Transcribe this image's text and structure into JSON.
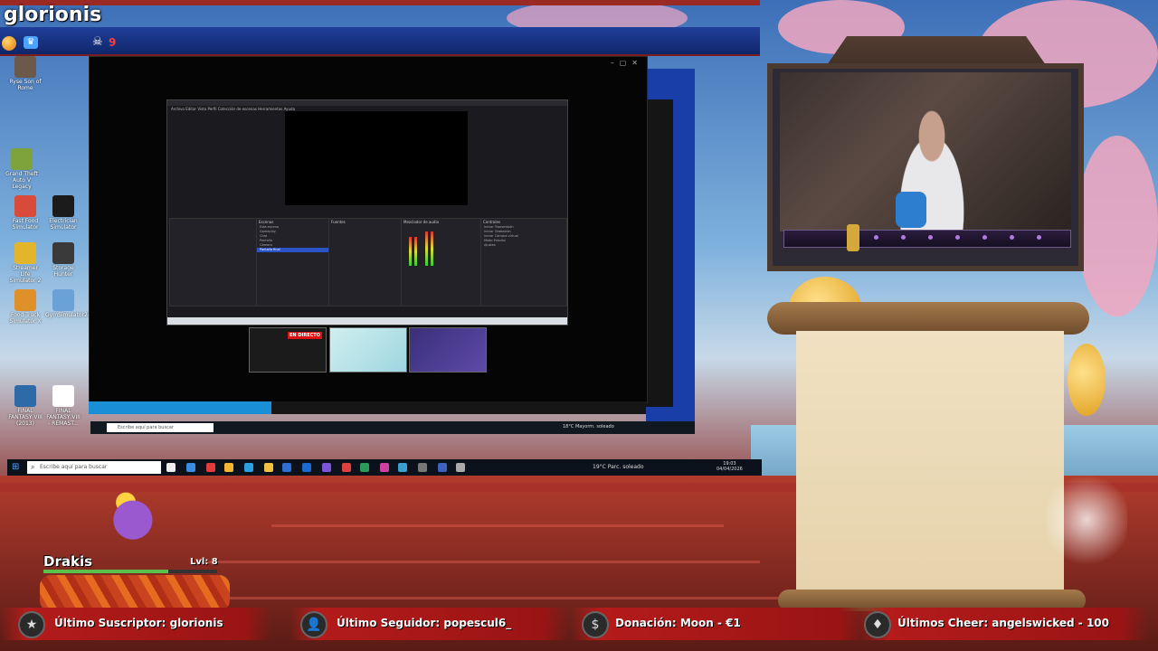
{
  "overlay": {
    "channel_name": "glorionis",
    "death_count": "9"
  },
  "desktop_icons": [
    {
      "label": "Ryse Son of Rome",
      "color": "#6b5a4a"
    },
    {
      "label": "Grand Theft Auto V Legacy",
      "color": "#7ea33c"
    },
    {
      "label": "Fast Food Simulator",
      "color": "#d84a3a"
    },
    {
      "label": "Electrician Simulator",
      "color": "#1b1b1b"
    },
    {
      "label": "Streamer Life Simulator 2",
      "color": "#e2b52b"
    },
    {
      "label": "Storage Hunter",
      "color": "#3a3a3a"
    },
    {
      "label": "Food Truck Simulator X",
      "color": "#e0902a"
    },
    {
      "label": "GymSimulator24",
      "color": "#6aa2d8"
    },
    {
      "label": "FINAL FANTASY VIII (2013)",
      "color": "#2e6aa8"
    },
    {
      "label": "FINAL FANTASY VIII - REMAST...",
      "color": "#ffffff"
    }
  ],
  "obs": {
    "live_badge": "EN DIRECTO",
    "mini_search_placeholder": "Escribe aquí para buscar",
    "mini_weather": "18°C Mayorm. soleado",
    "inner_menu": "Archivo  Editar  Vista  Perfil  Colección de escenas  Herramientas  Ayuda",
    "scenes_header": "Escenas",
    "scenes": [
      "Esta escena",
      "Gameplay",
      "Chat",
      "Pantalla",
      "Cámara",
      "Pantalla final"
    ],
    "selected_scene_index": 5,
    "sources_header": "Fuentes",
    "mixer_header": "Mezclador de audio",
    "controls_header": "Controles",
    "controls": [
      "Iniciar Transmisión",
      "Iniciar Grabación",
      "Iniciar Cámara virtual",
      "Modo Estudio",
      "Ajustes"
    ]
  },
  "taskbar": {
    "search_placeholder": "Escribe aquí para buscar",
    "weather": "19°C Parc. soleado",
    "time": "19:03",
    "date": "04/04/2026"
  },
  "character": {
    "name": "Drakis",
    "level": "Lvl: 8",
    "hp_fraction": 0.72
  },
  "ticker": {
    "subscriber": "Último Suscriptor: glorionis",
    "follower": "Último Seguidor: popescul6_",
    "donation": "Donación: Moon - €1",
    "cheer": "Últimos Cheer: angelswicked - 100"
  },
  "colors": {
    "live_red": "#dd1111",
    "ticker_red": "#b41b1b",
    "selection_blue": "#2b54c6"
  }
}
